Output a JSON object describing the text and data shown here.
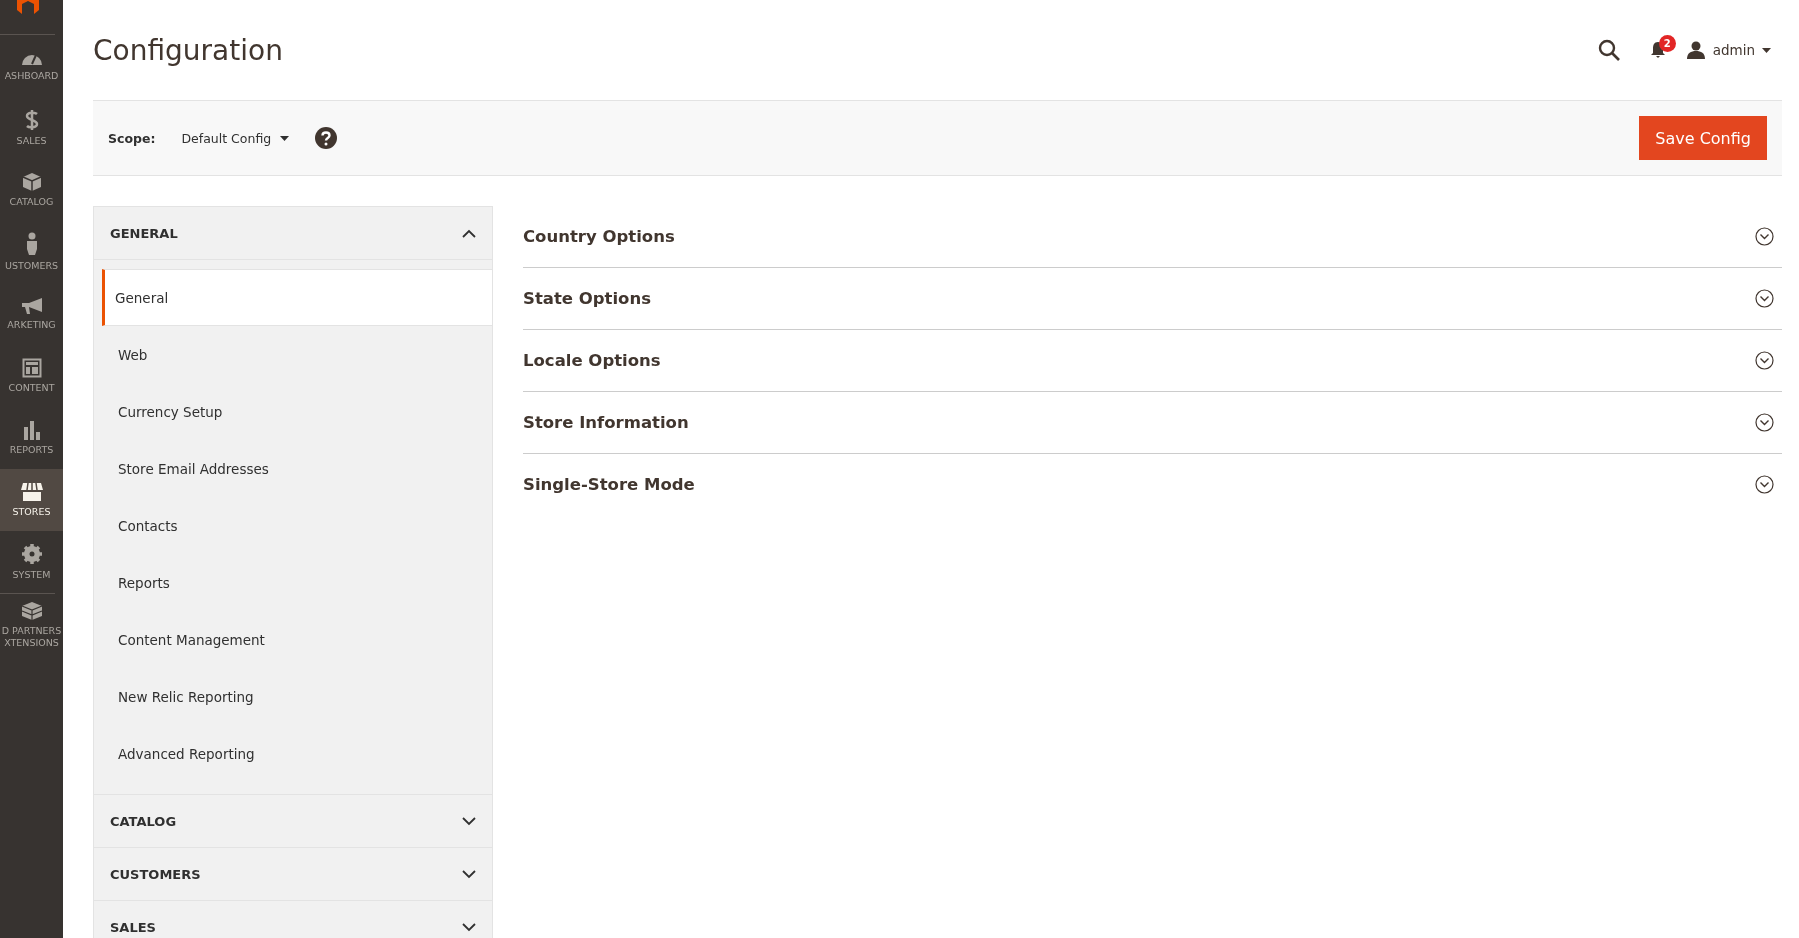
{
  "admin_menu": [
    {
      "label": "ASHBOARD",
      "selected": false
    },
    {
      "label": "SALES",
      "selected": false
    },
    {
      "label": "CATALOG",
      "selected": false
    },
    {
      "label": "USTOMERS",
      "selected": false
    },
    {
      "label": "ARKETING",
      "selected": false
    },
    {
      "label": "CONTENT",
      "selected": false
    },
    {
      "label": "REPORTS",
      "selected": false
    },
    {
      "label": "STORES",
      "selected": true
    },
    {
      "label": "SYSTEM",
      "selected": false
    },
    {
      "label": "D PARTNERS XTENSIONS",
      "selected": false
    }
  ],
  "header": {
    "title": "Configuration",
    "notifications": "2",
    "user": "admin"
  },
  "scope_bar": {
    "label": "Scope:",
    "value": "Default Config",
    "button": "Save Config"
  },
  "config_tabs": [
    {
      "label": "GENERAL",
      "expanded": true,
      "children": [
        {
          "label": "General",
          "selected": true
        },
        {
          "label": "Web",
          "selected": false
        },
        {
          "label": "Currency Setup",
          "selected": false
        },
        {
          "label": "Store Email Addresses",
          "selected": false
        },
        {
          "label": "Contacts",
          "selected": false
        },
        {
          "label": "Reports",
          "selected": false
        },
        {
          "label": "Content Management",
          "selected": false
        },
        {
          "label": "New Relic Reporting",
          "selected": false
        },
        {
          "label": "Advanced Reporting",
          "selected": false
        }
      ]
    },
    {
      "label": "CATALOG",
      "expanded": false
    },
    {
      "label": "CUSTOMERS",
      "expanded": false
    },
    {
      "label": "SALES",
      "expanded": false
    }
  ],
  "sections": [
    {
      "title": "Country Options",
      "expanded": false
    },
    {
      "title": "State Options",
      "expanded": false
    },
    {
      "title": "Locale Options",
      "expanded": false
    },
    {
      "title": "Store Information",
      "expanded": false
    },
    {
      "title": "Single-Store Mode",
      "expanded": false
    }
  ]
}
